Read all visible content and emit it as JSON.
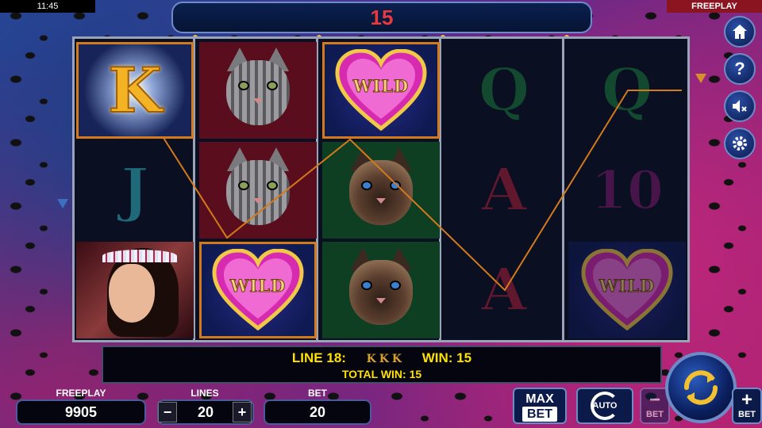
{
  "status": {
    "clock": "11:45",
    "mode": "FREEPLAY"
  },
  "top_win_display": "15",
  "reels": [
    [
      "K",
      "J",
      "lady"
    ],
    [
      "tabby-cat",
      "tabby-cat",
      "WILD"
    ],
    [
      "WILD",
      "siamese-cat",
      "siamese-cat"
    ],
    [
      "Q",
      "A",
      "A"
    ],
    [
      "Q",
      "10",
      "WILD"
    ]
  ],
  "symbols": {
    "k": "K",
    "j": "J",
    "q": "Q",
    "a": "A",
    "ten": "10",
    "wild": "WILD"
  },
  "winning_line": {
    "line_label": "LINE 18:",
    "win_label": "WIN: 15",
    "total_win_label": "TOTAL WIN: 15",
    "line_color": "#d27a1c"
  },
  "controls": {
    "freeplay": {
      "label": "FREEPLAY",
      "value": "9905"
    },
    "lines": {
      "label": "LINES",
      "value": "20",
      "minus": "−",
      "plus": "+"
    },
    "bet": {
      "label": "BET",
      "value": "20"
    },
    "max_bet": {
      "line1": "MAX",
      "line2": "BET"
    },
    "auto": "AUTO",
    "bet_minus": {
      "sign": "−",
      "label": "BET"
    },
    "bet_plus": {
      "sign": "+",
      "label": "BET"
    }
  },
  "side_icons": [
    "home-icon",
    "help-icon",
    "mute-icon",
    "settings-icon"
  ],
  "colors": {
    "accent": "#ffe100",
    "highlight": "#d27a1c",
    "win_red": "#e83a3a",
    "frame": "#6e8bc8"
  }
}
